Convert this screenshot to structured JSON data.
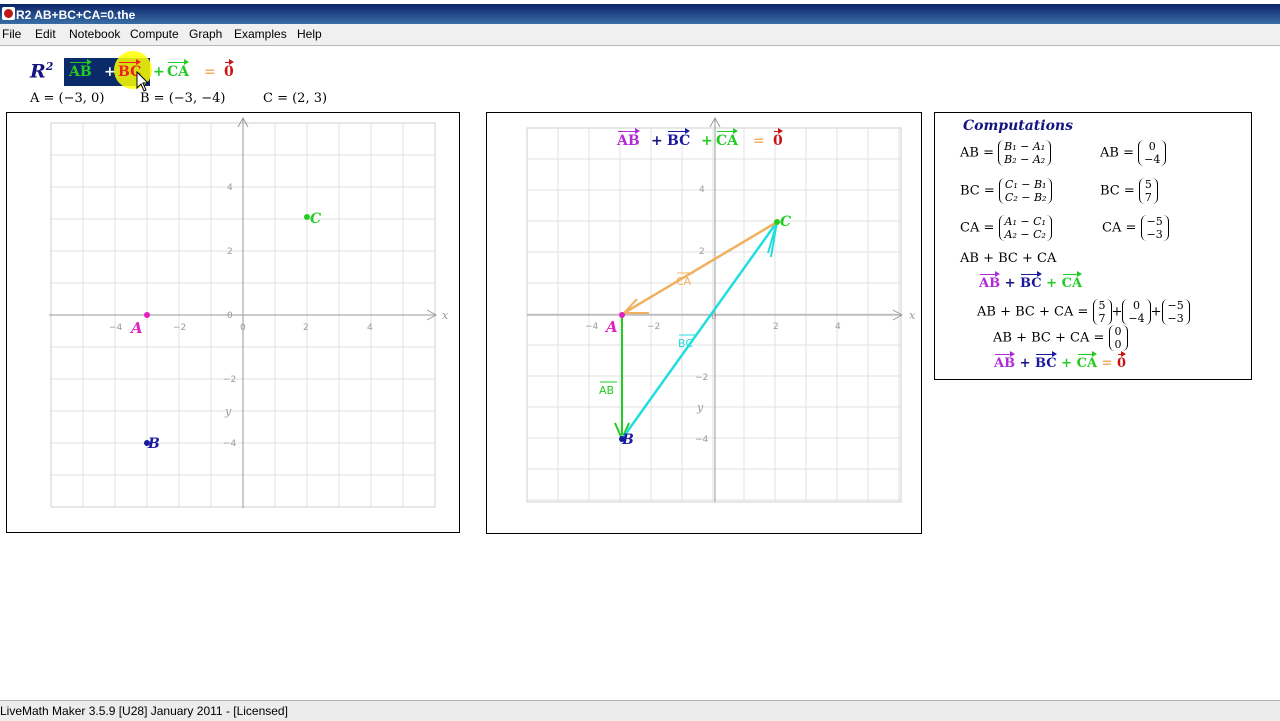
{
  "window": {
    "title": "R2  AB+BC+CA=0.the"
  },
  "menu": [
    "File",
    "Edit",
    "Notebook",
    "Compute",
    "Graph",
    "Examples",
    "Help"
  ],
  "header": {
    "space_label": "R",
    "space_exp": "2",
    "eq_ab": "AB",
    "eq_plus1": "+",
    "eq_bc": "BC",
    "eq_plus2": "+",
    "eq_ca": "CA",
    "eq_equals": "=",
    "eq_zero": "0",
    "point_a": "A = (−3, 0)",
    "point_b": "B = (−3, −4)",
    "point_c": "C = (2, 3)"
  },
  "graph1": {
    "xticks": [
      "−4",
      "−2",
      "0",
      "2",
      "4"
    ],
    "yticks": [
      "4",
      "2",
      "0",
      "−2",
      "−4"
    ],
    "xaxis": "x",
    "yaxis": "y",
    "labels": {
      "a": "A",
      "b": "B",
      "c": "C"
    }
  },
  "graph2": {
    "title_ab": "AB",
    "title_plus1": "+",
    "title_bc": "BC",
    "title_plus2": "+",
    "title_ca": "CA",
    "title_equals": "=",
    "title_zero": "0",
    "xticks": [
      "−4",
      "−2",
      "0",
      "2",
      "4"
    ],
    "yticks": [
      "4",
      "2",
      "−2",
      "−4"
    ],
    "xaxis": "x",
    "yaxis": "y",
    "labels": {
      "a": "A",
      "b": "B",
      "c": "C",
      "ab": "AB",
      "bc": "BC",
      "ca": "CA"
    }
  },
  "computations": {
    "title": "Computations",
    "ab_lhs": "AB =",
    "ab_top": "B₁ − A₁",
    "ab_bot": "B₂ − A₂",
    "ab_res_lhs": "AB =",
    "ab_res_top": "0",
    "ab_res_bot": "−4",
    "bc_lhs": "BC =",
    "bc_top": "C₁ − B₁",
    "bc_bot": "C₂ − B₂",
    "bc_res_lhs": "BC =",
    "bc_res_top": "5",
    "bc_res_bot": "7",
    "ca_lhs": "CA =",
    "ca_top": "A₁ − C₁",
    "ca_bot": "A₂ − C₂",
    "ca_res_lhs": "CA =",
    "ca_res_top": "−5",
    "ca_res_bot": "−3",
    "sum_line": "AB + BC + CA",
    "vec_ab": "AB",
    "vec_plus1": "+",
    "vec_bc": "BC",
    "vec_plus2": "+",
    "vec_ca": "CA",
    "sum_eq_lhs": "AB + BC + CA =",
    "s1_top": "5",
    "s1_bot": "7",
    "plus_a": "+",
    "s2_top": "0",
    "s2_bot": "−4",
    "plus_b": "+",
    "s3_top": "−5",
    "s3_bot": "−3",
    "zero_lhs": "AB + BC + CA =",
    "z_top": "0",
    "z_bot": "0",
    "final_ab": "AB",
    "final_plus1": "+",
    "final_bc": "BC",
    "final_plus2": "+",
    "final_ca": "CA",
    "final_equals": "=",
    "final_zero": "0"
  },
  "status": {
    "text": "LiveMath Maker 3.5.9 [U28] January 2011 - [Licensed]"
  },
  "colors": {
    "ab": "#22cc22",
    "bc": "#22dddd",
    "ca": "#f0b060",
    "a": "#e020c0",
    "b": "#1a1aa0",
    "c": "#22cc22",
    "zero": "#cc1111",
    "magenta_text": "#b02ad8",
    "navy": "#141480",
    "highlight": "#0a2a6a",
    "cursor": "#ffff00"
  }
}
